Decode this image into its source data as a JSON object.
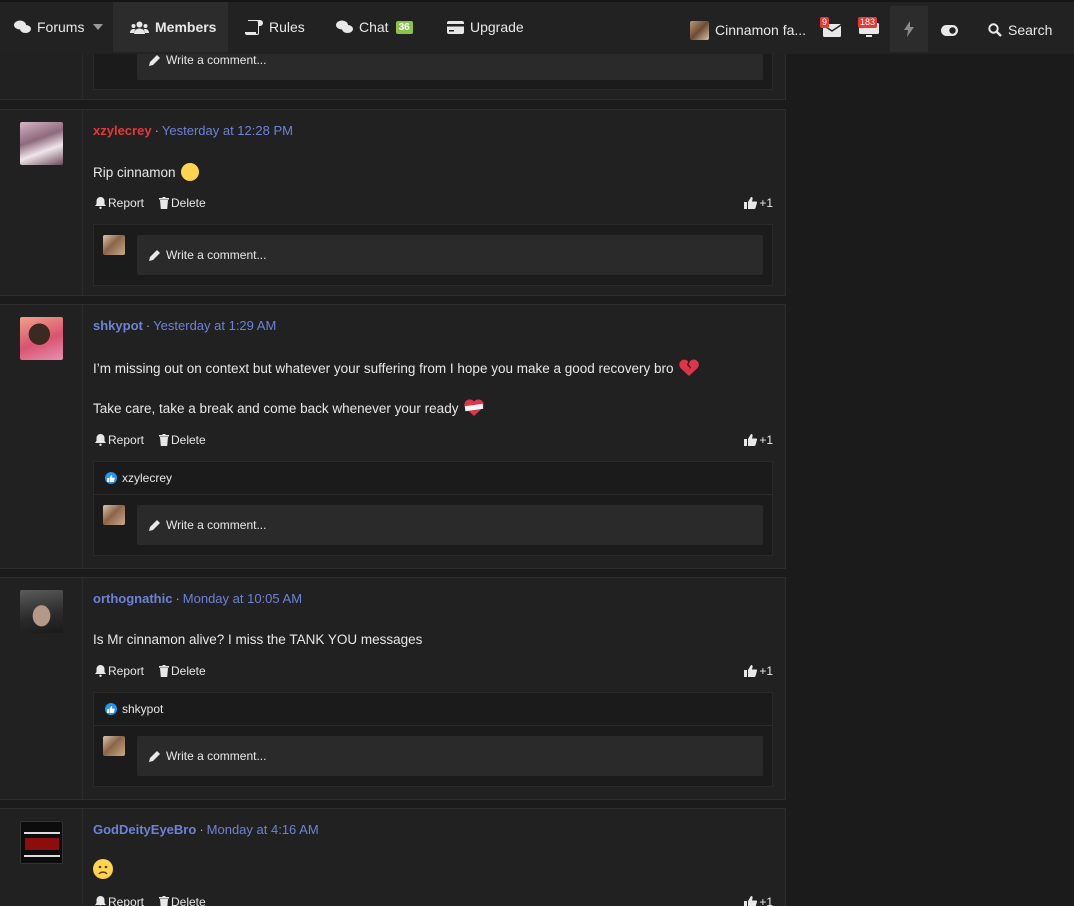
{
  "nav": {
    "forums": "Forums",
    "members": "Members",
    "rules": "Rules",
    "chat": "Chat",
    "chat_count": "36",
    "upgrade": "Upgrade",
    "user_label": "Cinnamon fa...",
    "inbox_count": "9",
    "alerts_count": "183",
    "search": "Search"
  },
  "common": {
    "report": "Report",
    "delete": "Delete",
    "like_count": "+1",
    "comment_placeholder": "Write a comment..."
  },
  "posts": [
    {
      "username": "xzylecrey",
      "time": "Yesterday at 12:28 PM",
      "lines": [
        "Rip cinnamon"
      ],
      "liked_by": ""
    },
    {
      "username": "shkypot",
      "time": "Yesterday at 1:29 AM",
      "lines": [
        "I’m missing out on context but whatever your suffering from I hope you make a good recovery bro",
        "Take care, take a break and come back whenever your ready"
      ],
      "liked_by": "xzylecrey"
    },
    {
      "username": "orthognathic",
      "time": "Monday at 10:05 AM",
      "lines": [
        "Is Mr cinnamon alive? I miss the TANK YOU messages"
      ],
      "liked_by": "shkypot"
    },
    {
      "username": "GodDeityEyeBro",
      "time": "Monday at 4:16 AM",
      "lines": [
        ""
      ],
      "liked_by": ""
    }
  ],
  "icons": {
    "forums": "chat-bubbles-icon",
    "members": "users-icon",
    "rules": "scroll-icon",
    "chat": "chat-icon",
    "upgrade": "credit-card-icon",
    "report": "bell-icon",
    "delete": "trash-icon",
    "like": "thumbs-up-icon",
    "comment": "pencil-icon"
  },
  "colors": {
    "red_user": "#e53935",
    "blue_user": "#6d82d6",
    "chat_badge": "#8bc34a",
    "alert_badge": "#e53935"
  }
}
